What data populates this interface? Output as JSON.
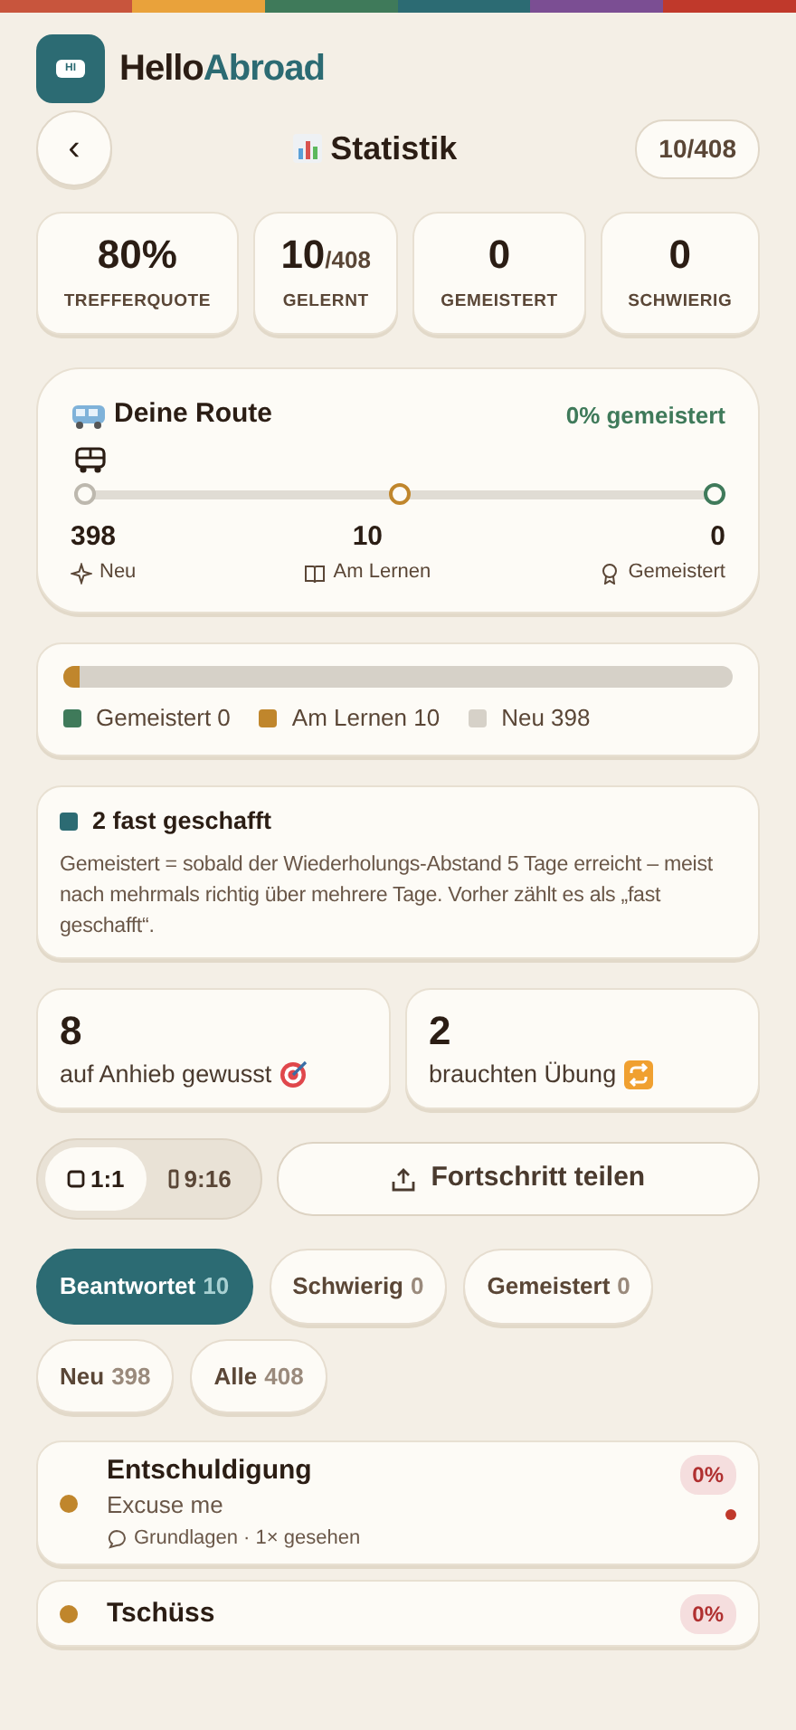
{
  "brand": {
    "logo_text": "HI",
    "name_a": "Hello",
    "name_b": "Abroad"
  },
  "header": {
    "back": "‹",
    "title": "Statistik",
    "counter": "10/408"
  },
  "stats": [
    {
      "value": "80%",
      "label": "TREFFERQUOTE"
    },
    {
      "value": "10",
      "suffix": "/408",
      "label": "GELERNT"
    },
    {
      "value": "0",
      "label": "GEMEISTERT"
    },
    {
      "value": "0",
      "label": "SCHWIERIG"
    }
  ],
  "route": {
    "title": "Deine Route",
    "percent": "0%",
    "percent_label": "gemeistert",
    "level": 0,
    "stops": [
      {
        "value": "398",
        "label": "Neu",
        "kind": "new",
        "color": "#bdb8ae"
      },
      {
        "value": "10",
        "label": "Am Lernen",
        "kind": "learning",
        "color": "#c0862c"
      },
      {
        "value": "0",
        "label": "Gemeistert",
        "kind": "mastered",
        "color": "#3f7a5a"
      }
    ]
  },
  "progress": {
    "level": 0.0245,
    "segments": [
      {
        "label": "Gemeistert 0",
        "color": "#3f7a5a"
      },
      {
        "label": "Am Lernen 10",
        "color": "#c0862c"
      },
      {
        "label": "Neu 398",
        "color": "#d6d1c8"
      }
    ]
  },
  "info": {
    "title": "2 fast geschafft",
    "color": "#2c6b73",
    "text": "Gemeistert = sobald der Wiederholungs-Abstand 5 Tage erreicht – meist nach mehrmals richtig über mehrere Tage. Vorher zählt es als „fast geschafft“."
  },
  "tallies": [
    {
      "value": "8",
      "label": "auf Anhieb gewusst",
      "kind": "target"
    },
    {
      "value": "2",
      "label": "brauchten Übung",
      "kind": "repeat"
    }
  ],
  "formats": [
    {
      "label": "1:1",
      "kind": "square",
      "selected": true
    },
    {
      "label": "9:16",
      "kind": "portrait",
      "selected": false
    }
  ],
  "share": {
    "label": "Fortschritt teilen"
  },
  "filters": [
    {
      "label": "Beantwortet",
      "count": "10",
      "selected": true
    },
    {
      "label": "Schwierig",
      "count": "0",
      "selected": false
    },
    {
      "label": "Gemeistert",
      "count": "0",
      "selected": false
    },
    {
      "label": "Neu",
      "count": "398",
      "selected": false
    },
    {
      "label": "Alle",
      "count": "408",
      "selected": false
    }
  ],
  "words": [
    {
      "word": "Entschuldigung",
      "translation": "Excuse me",
      "meta": "Grundlagen · 1× gesehen",
      "percent": "0%",
      "color": "#c0862c",
      "flag": true
    },
    {
      "word": "Tschüss",
      "percent": "0%",
      "color": "#c0862c"
    }
  ]
}
